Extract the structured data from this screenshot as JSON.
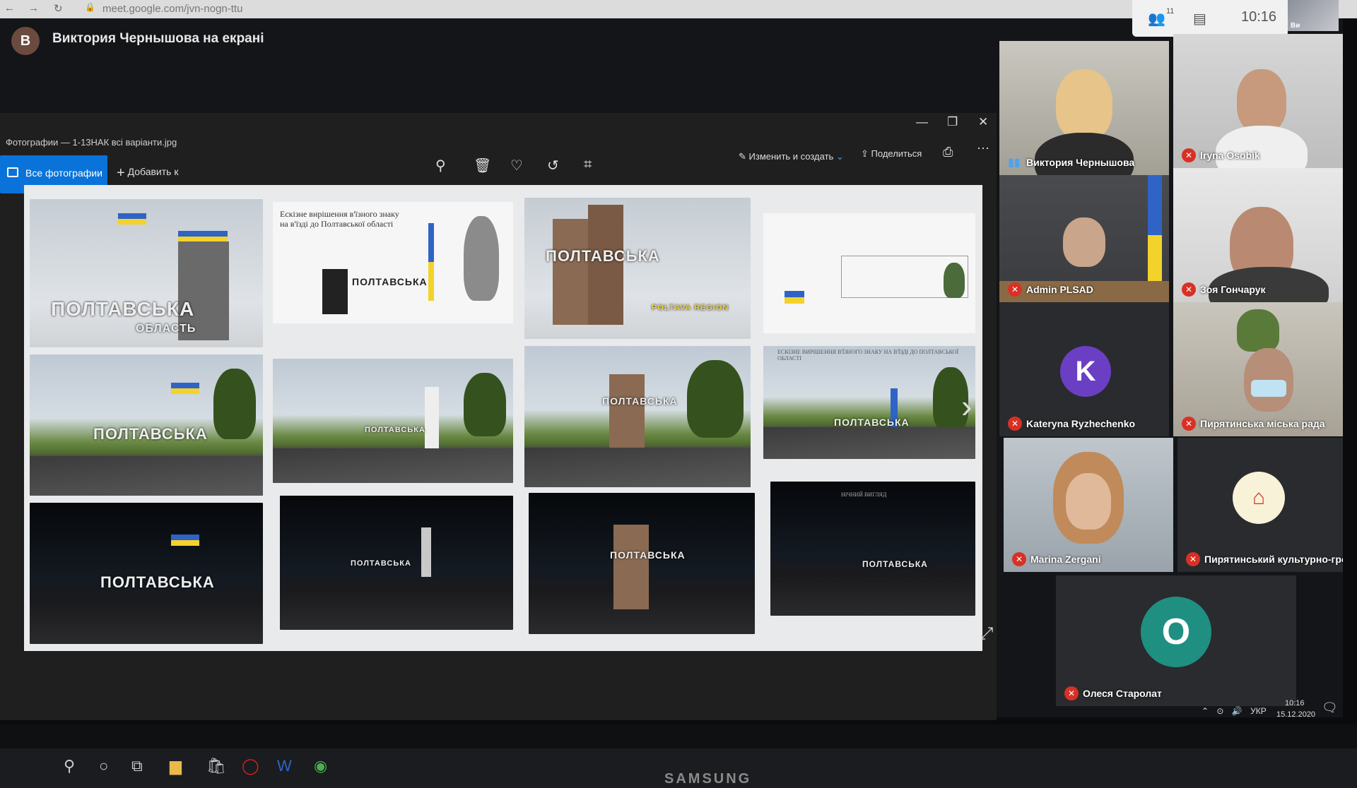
{
  "browser": {
    "url": "meet.google.com/jvn-nogn-ttu"
  },
  "meet_top": {
    "people_count": "11",
    "time": "10:16",
    "self_label": "Ви"
  },
  "presenter": {
    "initial": "В",
    "text": "Виктория Чернышова на екрані"
  },
  "photos_app": {
    "title": "Фотографии — 1-13НАК всі варіанти.jpg",
    "all_photos_label": "Все фотографии",
    "add_label": "Добавить к",
    "edit_label": "Изменить и создать",
    "share_label": "Поделиться"
  },
  "sheet": {
    "plan_text": "Ескізне вирішення в'їзного знаку на в'їзді до Полтавської області",
    "sign_main": "ПОЛТАВСЬКА",
    "sign_sub": "ОБЛАСТЬ",
    "sign_region": "POLTAVA REGION",
    "plan_small_title": "ЕСКІЗНЕ ВИРІШЕННЯ В'ЇЗНОГО ЗНАКУ НА В'ЇЗДІ ДО ПОЛТАВСЬКОЇ ОБЛАСТІ",
    "night_label": "НІЧНИЙ ВИГЛЯД"
  },
  "participants": [
    {
      "name": "Виктория Чернышова",
      "state": "speaking"
    },
    {
      "name": "Iryna Osobik",
      "state": "muted"
    },
    {
      "name": "Admin PLSAD",
      "state": "muted"
    },
    {
      "name": "Зоя Гончарук",
      "state": "muted"
    },
    {
      "name": "Kateryna Ryzhechenko",
      "state": "muted",
      "initial": "K"
    },
    {
      "name": "Пирятинська міська рада",
      "state": "muted"
    },
    {
      "name": "Marina Zergani",
      "state": "muted"
    },
    {
      "name": "Пирятинський культурно-гро...",
      "state": "muted"
    },
    {
      "name": "Олеся Старолат",
      "state": "muted",
      "initial": "O"
    }
  ],
  "tray": {
    "lang": "УКР",
    "time": "10:16",
    "date": "15.12.2020"
  },
  "monitor": {
    "brand": "SAMSUNG"
  },
  "colors": {
    "accent": "#0a73d9",
    "mute": "#d93025",
    "avatar_k": "#6a3fc4",
    "avatar_o": "#1f8f82"
  }
}
